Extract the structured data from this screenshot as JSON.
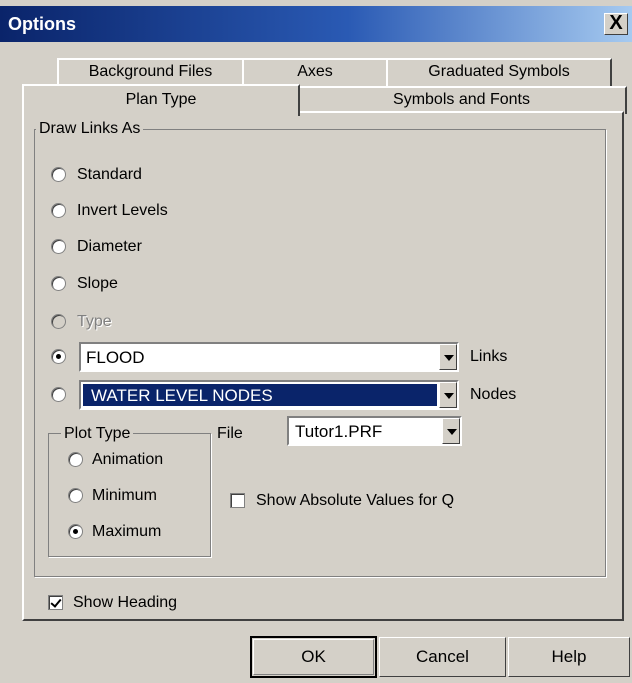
{
  "window": {
    "title": "Options",
    "close_glyph": "X"
  },
  "tabs": {
    "back_row": [
      "Background Files",
      "Axes",
      "Graduated Symbols"
    ],
    "front_row": [
      "Plan Type",
      "Symbols and Fonts"
    ],
    "active": "Plan Type"
  },
  "draw_links": {
    "legend": "Draw Links As",
    "options": [
      "Standard",
      "Invert Levels",
      "Diameter",
      "Slope",
      "Type"
    ],
    "disabled_option": "Type",
    "links_select": {
      "value": "FLOOD",
      "label": "Links",
      "selected": true
    },
    "nodes_select": {
      "value": "WATER LEVEL  NODES",
      "label": "Nodes",
      "selected": false
    }
  },
  "plot_type": {
    "legend": "Plot Type",
    "options": [
      "Animation",
      "Minimum",
      "Maximum"
    ],
    "selected": "Maximum"
  },
  "file": {
    "label": "File",
    "value": "Tutor1.PRF"
  },
  "show_absolute": {
    "label": "Show Absolute Values for Q",
    "checked": false
  },
  "show_heading": {
    "label": "Show Heading",
    "checked": true
  },
  "buttons": {
    "ok": "OK",
    "cancel": "Cancel",
    "help": "Help"
  },
  "colors": {
    "face": "#d4d0c8",
    "title_bar": "#0a246a",
    "selection": "#0a246a"
  }
}
